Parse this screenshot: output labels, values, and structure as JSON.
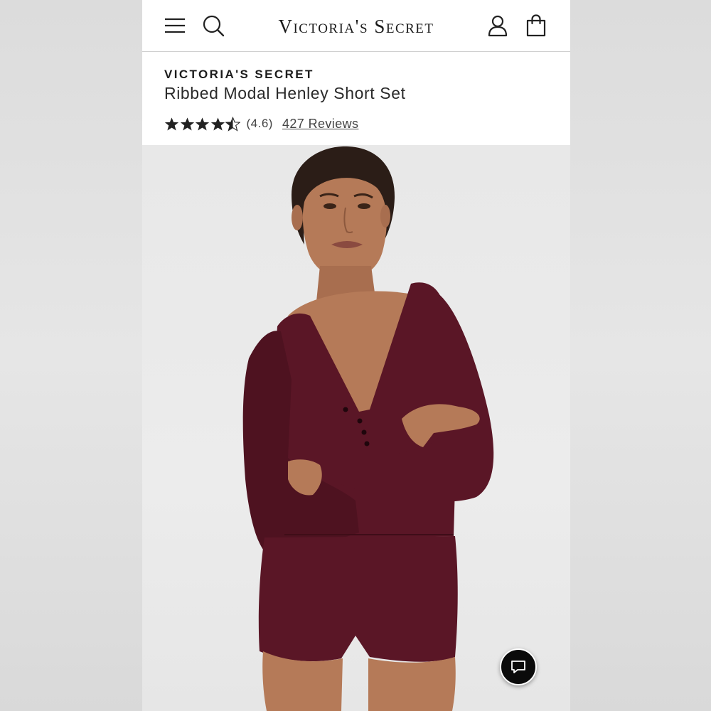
{
  "header": {
    "logo_text": "Victoria's Secret",
    "menu_icon": "menu-icon",
    "search_icon": "search-icon",
    "account_icon": "account-icon",
    "bag_icon": "shopping-bag-icon"
  },
  "product": {
    "brand": "VICTORIA'S SECRET",
    "name": "Ribbed Modal Henley Short Set",
    "rating": 4.6,
    "rating_text": "(4.6)",
    "reviews_text": "427 Reviews",
    "garment_color": "#5a1626"
  },
  "chat": {
    "icon": "chat-bubble-icon"
  },
  "colors": {
    "header_bg": "#ffffff",
    "text_primary": "#1c1c1c",
    "star_color": "#222222",
    "chat_bg": "#0b0b0b"
  }
}
